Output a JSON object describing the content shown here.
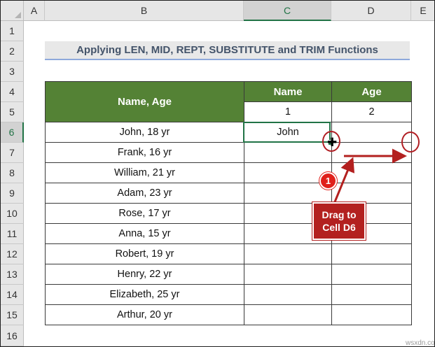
{
  "columns": [
    "A",
    "B",
    "C",
    "D",
    "E"
  ],
  "selected_column": "C",
  "rows": [
    "1",
    "2",
    "3",
    "4",
    "5",
    "6",
    "7",
    "8",
    "9",
    "10",
    "11",
    "12",
    "13",
    "14",
    "15",
    "16"
  ],
  "selected_row": "6",
  "title": "Applying LEN, MID, REPT, SUBSTITUTE and TRIM Functions",
  "table": {
    "header_main": "Name, Age",
    "header_name": "Name",
    "header_age": "Age",
    "index_name": "1",
    "index_age": "2",
    "data": [
      {
        "name_age": "John, 18 yr",
        "name": "John",
        "age": ""
      },
      {
        "name_age": "Frank, 16 yr",
        "name": "",
        "age": ""
      },
      {
        "name_age": "William, 21 yr",
        "name": "",
        "age": ""
      },
      {
        "name_age": "Adam, 23 yr",
        "name": "",
        "age": ""
      },
      {
        "name_age": "Rose, 17 yr",
        "name": "",
        "age": ""
      },
      {
        "name_age": "Anna, 15 yr",
        "name": "",
        "age": ""
      },
      {
        "name_age": "Robert, 19 yr",
        "name": "",
        "age": ""
      },
      {
        "name_age": "Henry, 22 yr",
        "name": "",
        "age": ""
      },
      {
        "name_age": "Elizabeth, 25 yr",
        "name": "",
        "age": ""
      },
      {
        "name_age": "Arthur, 20 yr",
        "name": "",
        "age": ""
      }
    ]
  },
  "annotation": {
    "step_number": "1",
    "callout_line1": "Drag to",
    "callout_line2": "Cell D6",
    "accent": "#b3201f"
  },
  "header_green": "#548235",
  "watermark": "wsxdn.com"
}
